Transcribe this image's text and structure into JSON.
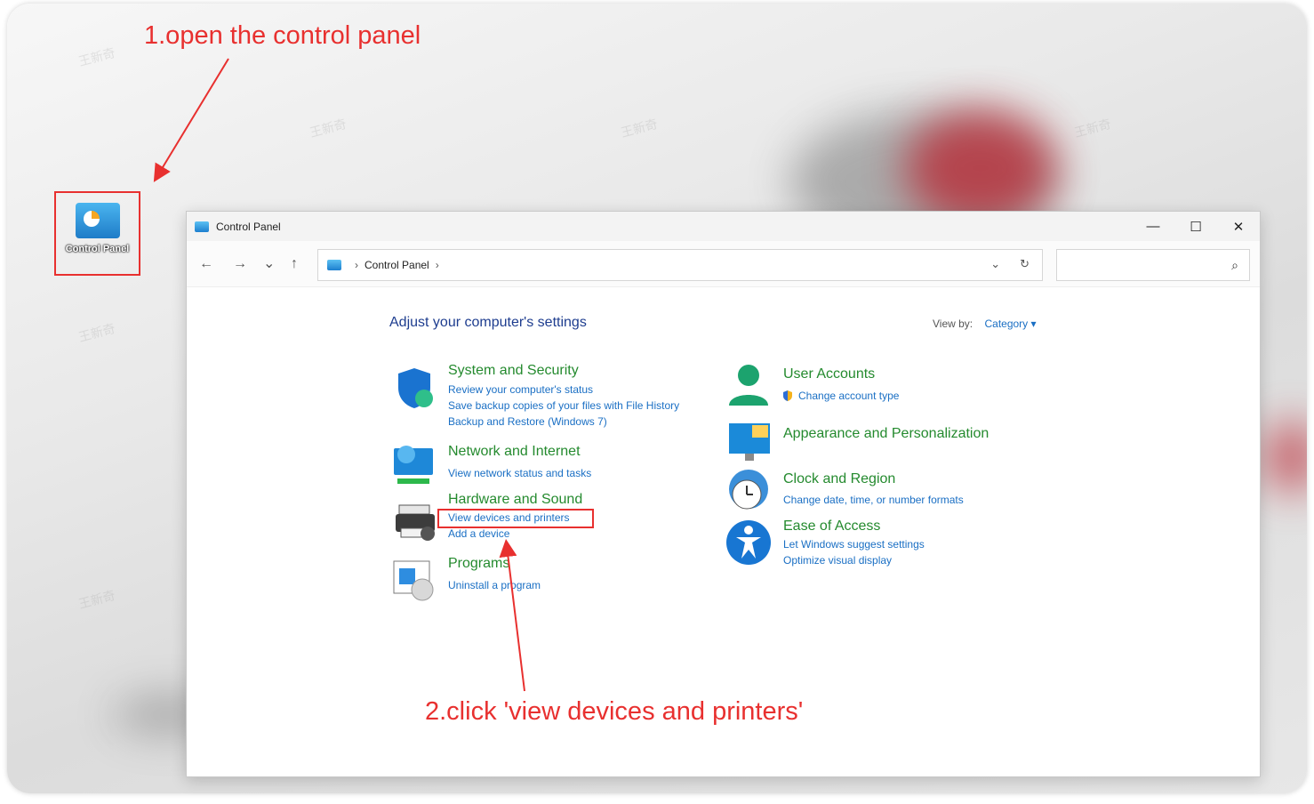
{
  "annotations": {
    "step1": "1.open the control panel",
    "step2": "2.click 'view devices and printers'"
  },
  "desktop_icon": {
    "label": "Control Panel",
    "icon": "control-panel-icon"
  },
  "window": {
    "title": "Control Panel",
    "controls": {
      "minimize": "—",
      "maximize": "☐",
      "close": "✕"
    }
  },
  "nav": {
    "back": "←",
    "forward": "→",
    "recent": "⌄",
    "up": "↑",
    "breadcrumb": "Control Panel",
    "dropdown": "⌄",
    "refresh": "↻",
    "search_placeholder": "",
    "search_icon": "⌕"
  },
  "main": {
    "heading": "Adjust your computer's settings",
    "view_by_label": "View by:",
    "view_by_value": "Category ▾"
  },
  "categories_left": [
    {
      "title": "System and Security",
      "icon": "shield-icon",
      "links": [
        "Review your computer's status",
        "Save backup copies of your files with File History",
        "Backup and Restore (Windows 7)"
      ]
    },
    {
      "title": "Network and Internet",
      "icon": "globe-monitor-icon",
      "links": [
        "View network status and tasks"
      ]
    },
    {
      "title": "Hardware and Sound",
      "icon": "printer-icon",
      "links": [
        "View devices and printers",
        "Add a device"
      ]
    },
    {
      "title": "Programs",
      "icon": "programs-disc-icon",
      "links": [
        "Uninstall a program"
      ]
    }
  ],
  "categories_right": [
    {
      "title": "User Accounts",
      "icon": "user-icon",
      "links": [
        "Change account type"
      ]
    },
    {
      "title": "Appearance and Personalization",
      "icon": "monitor-color-icon",
      "links": []
    },
    {
      "title": "Clock and Region",
      "icon": "clock-globe-icon",
      "links": [
        "Change date, time, or number formats"
      ]
    },
    {
      "title": "Ease of Access",
      "icon": "accessibility-icon",
      "links": [
        "Let Windows suggest settings",
        "Optimize visual display"
      ]
    }
  ],
  "colors": {
    "annotation_red": "#e8302f",
    "category_green": "#248a2e",
    "link_blue": "#1a6fc4",
    "heading_blue": "#1e3d8f"
  }
}
